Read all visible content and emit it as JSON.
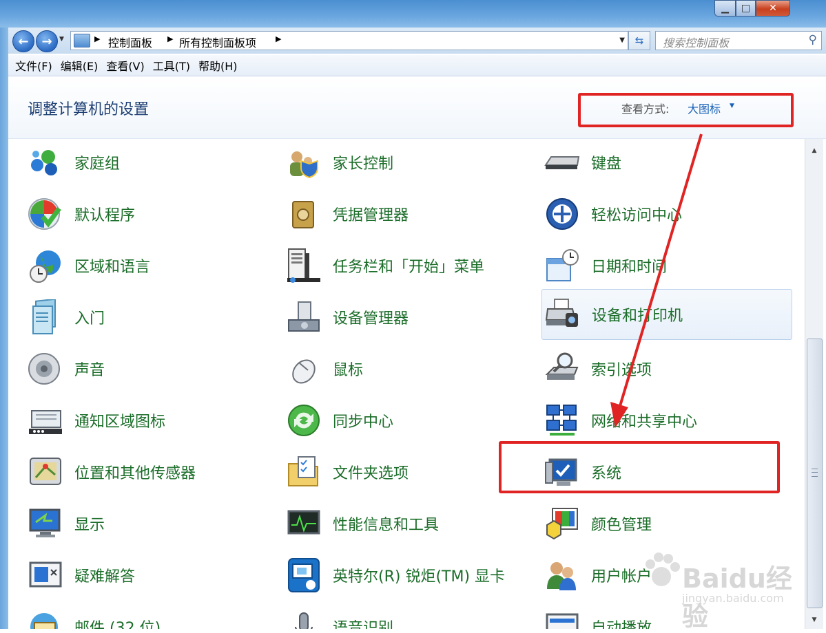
{
  "window": {
    "min_symbol": "▁",
    "max_symbol": "□",
    "close_symbol": "✕"
  },
  "address": {
    "breadcrumbs": [
      "控制面板",
      "所有控制面板项"
    ],
    "search_placeholder": "搜索控制面板"
  },
  "menu": [
    "文件(F)",
    "编辑(E)",
    "查看(V)",
    "工具(T)",
    "帮助(H)"
  ],
  "header": {
    "title": "调整计算机的设置",
    "view_label": "查看方式:",
    "view_value": "大图标"
  },
  "items": [
    {
      "label": "家庭组",
      "icon": "homegroup-icon"
    },
    {
      "label": "家长控制",
      "icon": "parental-controls-icon"
    },
    {
      "label": "键盘",
      "icon": "keyboard-icon"
    },
    {
      "label": "默认程序",
      "icon": "default-programs-icon"
    },
    {
      "label": "凭据管理器",
      "icon": "credential-manager-icon"
    },
    {
      "label": "轻松访问中心",
      "icon": "ease-of-access-icon"
    },
    {
      "label": "区域和语言",
      "icon": "region-language-icon"
    },
    {
      "label": "任务栏和「开始」菜单",
      "icon": "taskbar-start-icon"
    },
    {
      "label": "日期和时间",
      "icon": "date-time-icon"
    },
    {
      "label": "入门",
      "icon": "getting-started-icon"
    },
    {
      "label": "设备管理器",
      "icon": "device-manager-icon"
    },
    {
      "label": "设备和打印机",
      "icon": "devices-printers-icon"
    },
    {
      "label": "声音",
      "icon": "sound-icon"
    },
    {
      "label": "鼠标",
      "icon": "mouse-icon"
    },
    {
      "label": "索引选项",
      "icon": "indexing-options-icon"
    },
    {
      "label": "通知区域图标",
      "icon": "notification-icons-icon"
    },
    {
      "label": "同步中心",
      "icon": "sync-center-icon"
    },
    {
      "label": "网络和共享中心",
      "icon": "network-sharing-icon"
    },
    {
      "label": "位置和其他传感器",
      "icon": "location-sensors-icon"
    },
    {
      "label": "文件夹选项",
      "icon": "folder-options-icon"
    },
    {
      "label": "系统",
      "icon": "system-icon"
    },
    {
      "label": "显示",
      "icon": "display-icon"
    },
    {
      "label": "性能信息和工具",
      "icon": "performance-icon"
    },
    {
      "label": "颜色管理",
      "icon": "color-management-icon"
    },
    {
      "label": "疑难解答",
      "icon": "troubleshooting-icon"
    },
    {
      "label": "英特尔(R) 锐炬(TM) 显卡",
      "icon": "intel-graphics-icon"
    },
    {
      "label": "用户帐户",
      "icon": "user-accounts-icon"
    },
    {
      "label": "邮件 (32 位)",
      "icon": "mail-icon"
    },
    {
      "label": "语音识别",
      "icon": "speech-recognition-icon"
    },
    {
      "label": "自动播放",
      "icon": "autoplay-icon"
    }
  ],
  "watermark": {
    "brand": "Baidu经验",
    "url": "jingyan.baidu.com"
  }
}
